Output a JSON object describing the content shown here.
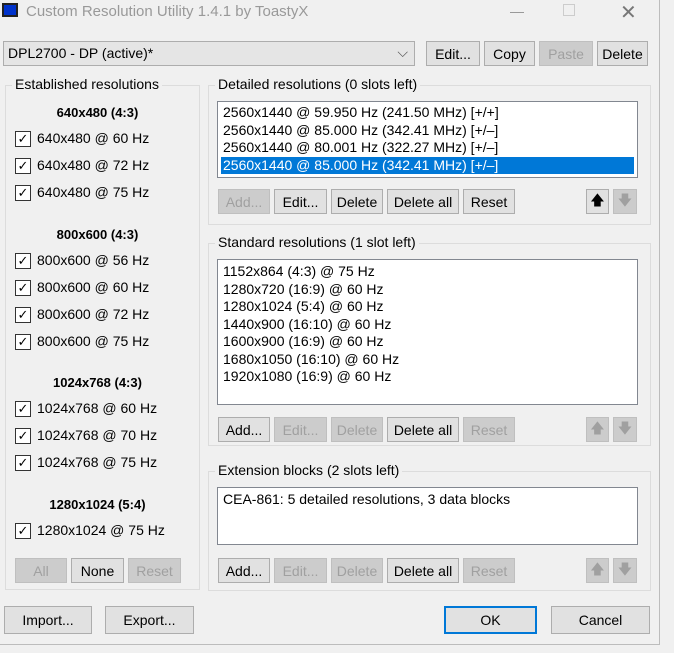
{
  "title": "Custom Resolution Utility 1.4.1 by ToastyX",
  "monitor": {
    "selected": "DPL2700 - DP (active)*",
    "edit": "Edit...",
    "copy": "Copy",
    "paste": "Paste",
    "delete": "Delete"
  },
  "established": {
    "label": "Established resolutions",
    "groups": [
      {
        "header": "640x480 (4:3)",
        "items": [
          "640x480 @ 60 Hz",
          "640x480 @ 72 Hz",
          "640x480 @ 75 Hz"
        ]
      },
      {
        "header": "800x600 (4:3)",
        "items": [
          "800x600 @ 56 Hz",
          "800x600 @ 60 Hz",
          "800x600 @ 72 Hz",
          "800x600 @ 75 Hz"
        ]
      },
      {
        "header": "1024x768 (4:3)",
        "items": [
          "1024x768 @ 60 Hz",
          "1024x768 @ 70 Hz",
          "1024x768 @ 75 Hz"
        ]
      },
      {
        "header": "1280x1024 (5:4)",
        "items": [
          "1280x1024 @ 75 Hz"
        ]
      }
    ],
    "all": "All",
    "none": "None",
    "reset": "Reset"
  },
  "detailed": {
    "label": "Detailed resolutions (0 slots left)",
    "items": [
      "2560x1440 @ 59.950 Hz (241.50 MHz) [+/+]",
      "2560x1440 @ 85.000 Hz (342.41 MHz) [+/–]",
      "2560x1440 @ 80.001 Hz (322.27 MHz) [+/–]",
      "2560x1440 @ 85.000 Hz (342.41 MHz) [+/–]"
    ],
    "selected_index": 3
  },
  "standard": {
    "label": "Standard resolutions (1 slot left)",
    "items": [
      "1152x864 (4:3) @ 75 Hz",
      "1280x720 (16:9) @ 60 Hz",
      "1280x1024 (5:4) @ 60 Hz",
      "1440x900 (16:10) @ 60 Hz",
      "1600x900 (16:9) @ 60 Hz",
      "1680x1050 (16:10) @ 60 Hz",
      "1920x1080 (16:9) @ 60 Hz"
    ]
  },
  "extension": {
    "label": "Extension blocks (2 slots left)",
    "items": [
      "CEA-861: 5 detailed resolutions, 3 data blocks"
    ]
  },
  "buttons": {
    "add": "Add...",
    "edit": "Edit...",
    "delete": "Delete",
    "delete_all": "Delete all",
    "reset": "Reset",
    "up": "🡅",
    "down": "🡇"
  },
  "footer": {
    "import": "Import...",
    "export": "Export...",
    "ok": "OK",
    "cancel": "Cancel"
  }
}
